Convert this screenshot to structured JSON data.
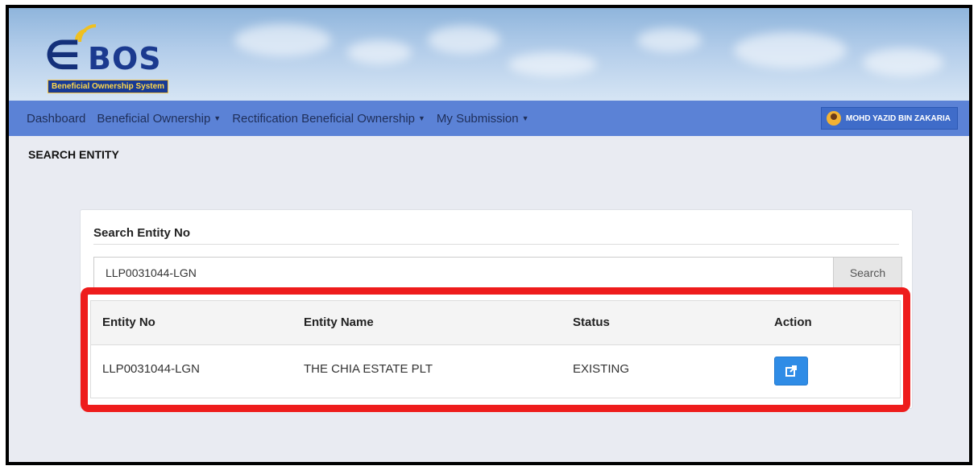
{
  "logo": {
    "text": "BOS",
    "subtitle": "Beneficial Ownership System"
  },
  "nav": {
    "items": [
      {
        "label": "Dashboard",
        "dropdown": false
      },
      {
        "label": "Beneficial Ownership",
        "dropdown": true
      },
      {
        "label": "Rectification Beneficial Ownership",
        "dropdown": true
      },
      {
        "label": "My Submission",
        "dropdown": true
      }
    ],
    "user": "MOHD YAZID BIN ZAKARIA"
  },
  "page": {
    "title": "SEARCH ENTITY"
  },
  "search": {
    "title": "Search Entity No",
    "value": "LLP0031044-LGN",
    "button": "Search"
  },
  "table": {
    "headers": [
      "Entity No",
      "Entity Name",
      "Status",
      "Action"
    ],
    "rows": [
      {
        "entity_no": "LLP0031044-LGN",
        "entity_name": "THE CHIA ESTATE PLT",
        "status": "EXISTING",
        "action_icon": "edit-external-icon"
      }
    ]
  },
  "colors": {
    "navbar": "#5b82d6",
    "highlight": "#ee1c1c",
    "action_button": "#2f8ce6"
  }
}
